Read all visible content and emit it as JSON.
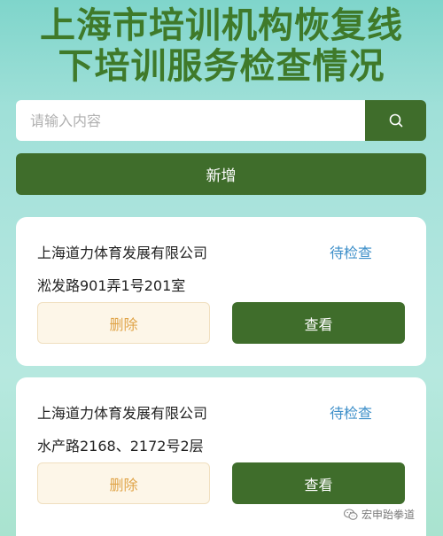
{
  "header": {
    "title_line1": "上海市培训机构恢复线",
    "title_line2": "下培训服务检查情况"
  },
  "search": {
    "placeholder": "请输入内容",
    "value": ""
  },
  "toolbar": {
    "add_label": "新增"
  },
  "cards": [
    {
      "company": "上海道力体育发展有限公司",
      "status": "待检查",
      "address": "淞发路901弄1号201室",
      "delete_label": "删除",
      "view_label": "查看"
    },
    {
      "company": "上海道力体育发展有限公司",
      "status": "待检查",
      "address": "水产路2168、2172号2层",
      "delete_label": "删除",
      "view_label": "查看"
    }
  ],
  "watermark": {
    "text": "宏申跆拳道"
  },
  "colors": {
    "primary": "#3f6d2b",
    "title": "#3f7a2a",
    "status": "#3d8fc9",
    "delete_text": "#e0a448"
  }
}
